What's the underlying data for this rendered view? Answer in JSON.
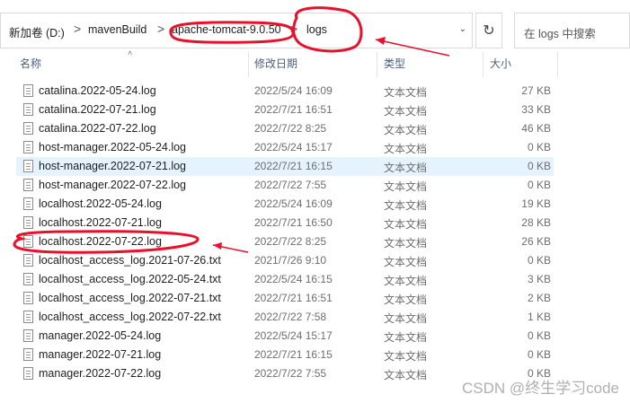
{
  "address_bar": {
    "segments": [
      "新加卷 (D:)",
      "mavenBuild",
      "apache-tomcat-9.0.50",
      "logs"
    ],
    "separator": ">",
    "history_dropdown_icon": "chevron-down-icon"
  },
  "refresh_icon": "refresh-icon",
  "search": {
    "placeholder": "在 logs 中搜索"
  },
  "columns": {
    "name": "名称",
    "date": "修改日期",
    "type": "类型",
    "size": "大小"
  },
  "files": [
    {
      "name": "catalina.2022-05-24.log",
      "date": "2022/5/24 16:09",
      "type": "文本文档",
      "size": "27 KB"
    },
    {
      "name": "catalina.2022-07-21.log",
      "date": "2022/7/21 16:51",
      "type": "文本文档",
      "size": "33 KB"
    },
    {
      "name": "catalina.2022-07-22.log",
      "date": "2022/7/22 8:25",
      "type": "文本文档",
      "size": "46 KB"
    },
    {
      "name": "host-manager.2022-05-24.log",
      "date": "2022/5/24 15:17",
      "type": "文本文档",
      "size": "0 KB"
    },
    {
      "name": "host-manager.2022-07-21.log",
      "date": "2022/7/21 16:15",
      "type": "文本文档",
      "size": "0 KB",
      "selected": true
    },
    {
      "name": "host-manager.2022-07-22.log",
      "date": "2022/7/22 7:55",
      "type": "文本文档",
      "size": "0 KB"
    },
    {
      "name": "localhost.2022-05-24.log",
      "date": "2022/5/24 16:09",
      "type": "文本文档",
      "size": "19 KB"
    },
    {
      "name": "localhost.2022-07-21.log",
      "date": "2022/7/21 16:50",
      "type": "文本文档",
      "size": "28 KB"
    },
    {
      "name": "localhost.2022-07-22.log",
      "date": "2022/7/22 8:25",
      "type": "文本文档",
      "size": "26 KB"
    },
    {
      "name": "localhost_access_log.2021-07-26.txt",
      "date": "2021/7/26 9:10",
      "type": "文本文档",
      "size": "0 KB"
    },
    {
      "name": "localhost_access_log.2022-05-24.txt",
      "date": "2022/5/24 16:15",
      "type": "文本文档",
      "size": "3 KB"
    },
    {
      "name": "localhost_access_log.2022-07-21.txt",
      "date": "2022/7/21 16:51",
      "type": "文本文档",
      "size": "2 KB"
    },
    {
      "name": "localhost_access_log.2022-07-22.txt",
      "date": "2022/7/22 7:58",
      "type": "文本文档",
      "size": "1 KB"
    },
    {
      "name": "manager.2022-05-24.log",
      "date": "2022/5/24 15:17",
      "type": "文本文档",
      "size": "0 KB"
    },
    {
      "name": "manager.2022-07-21.log",
      "date": "2022/7/21 16:15",
      "type": "文本文档",
      "size": "0 KB"
    },
    {
      "name": "manager.2022-07-22.log",
      "date": "2022/7/22 7:55",
      "type": "文本文档",
      "size": "0 KB"
    }
  ],
  "watermark": "CSDN @终生学习code",
  "annotation_color": "#e8102a"
}
